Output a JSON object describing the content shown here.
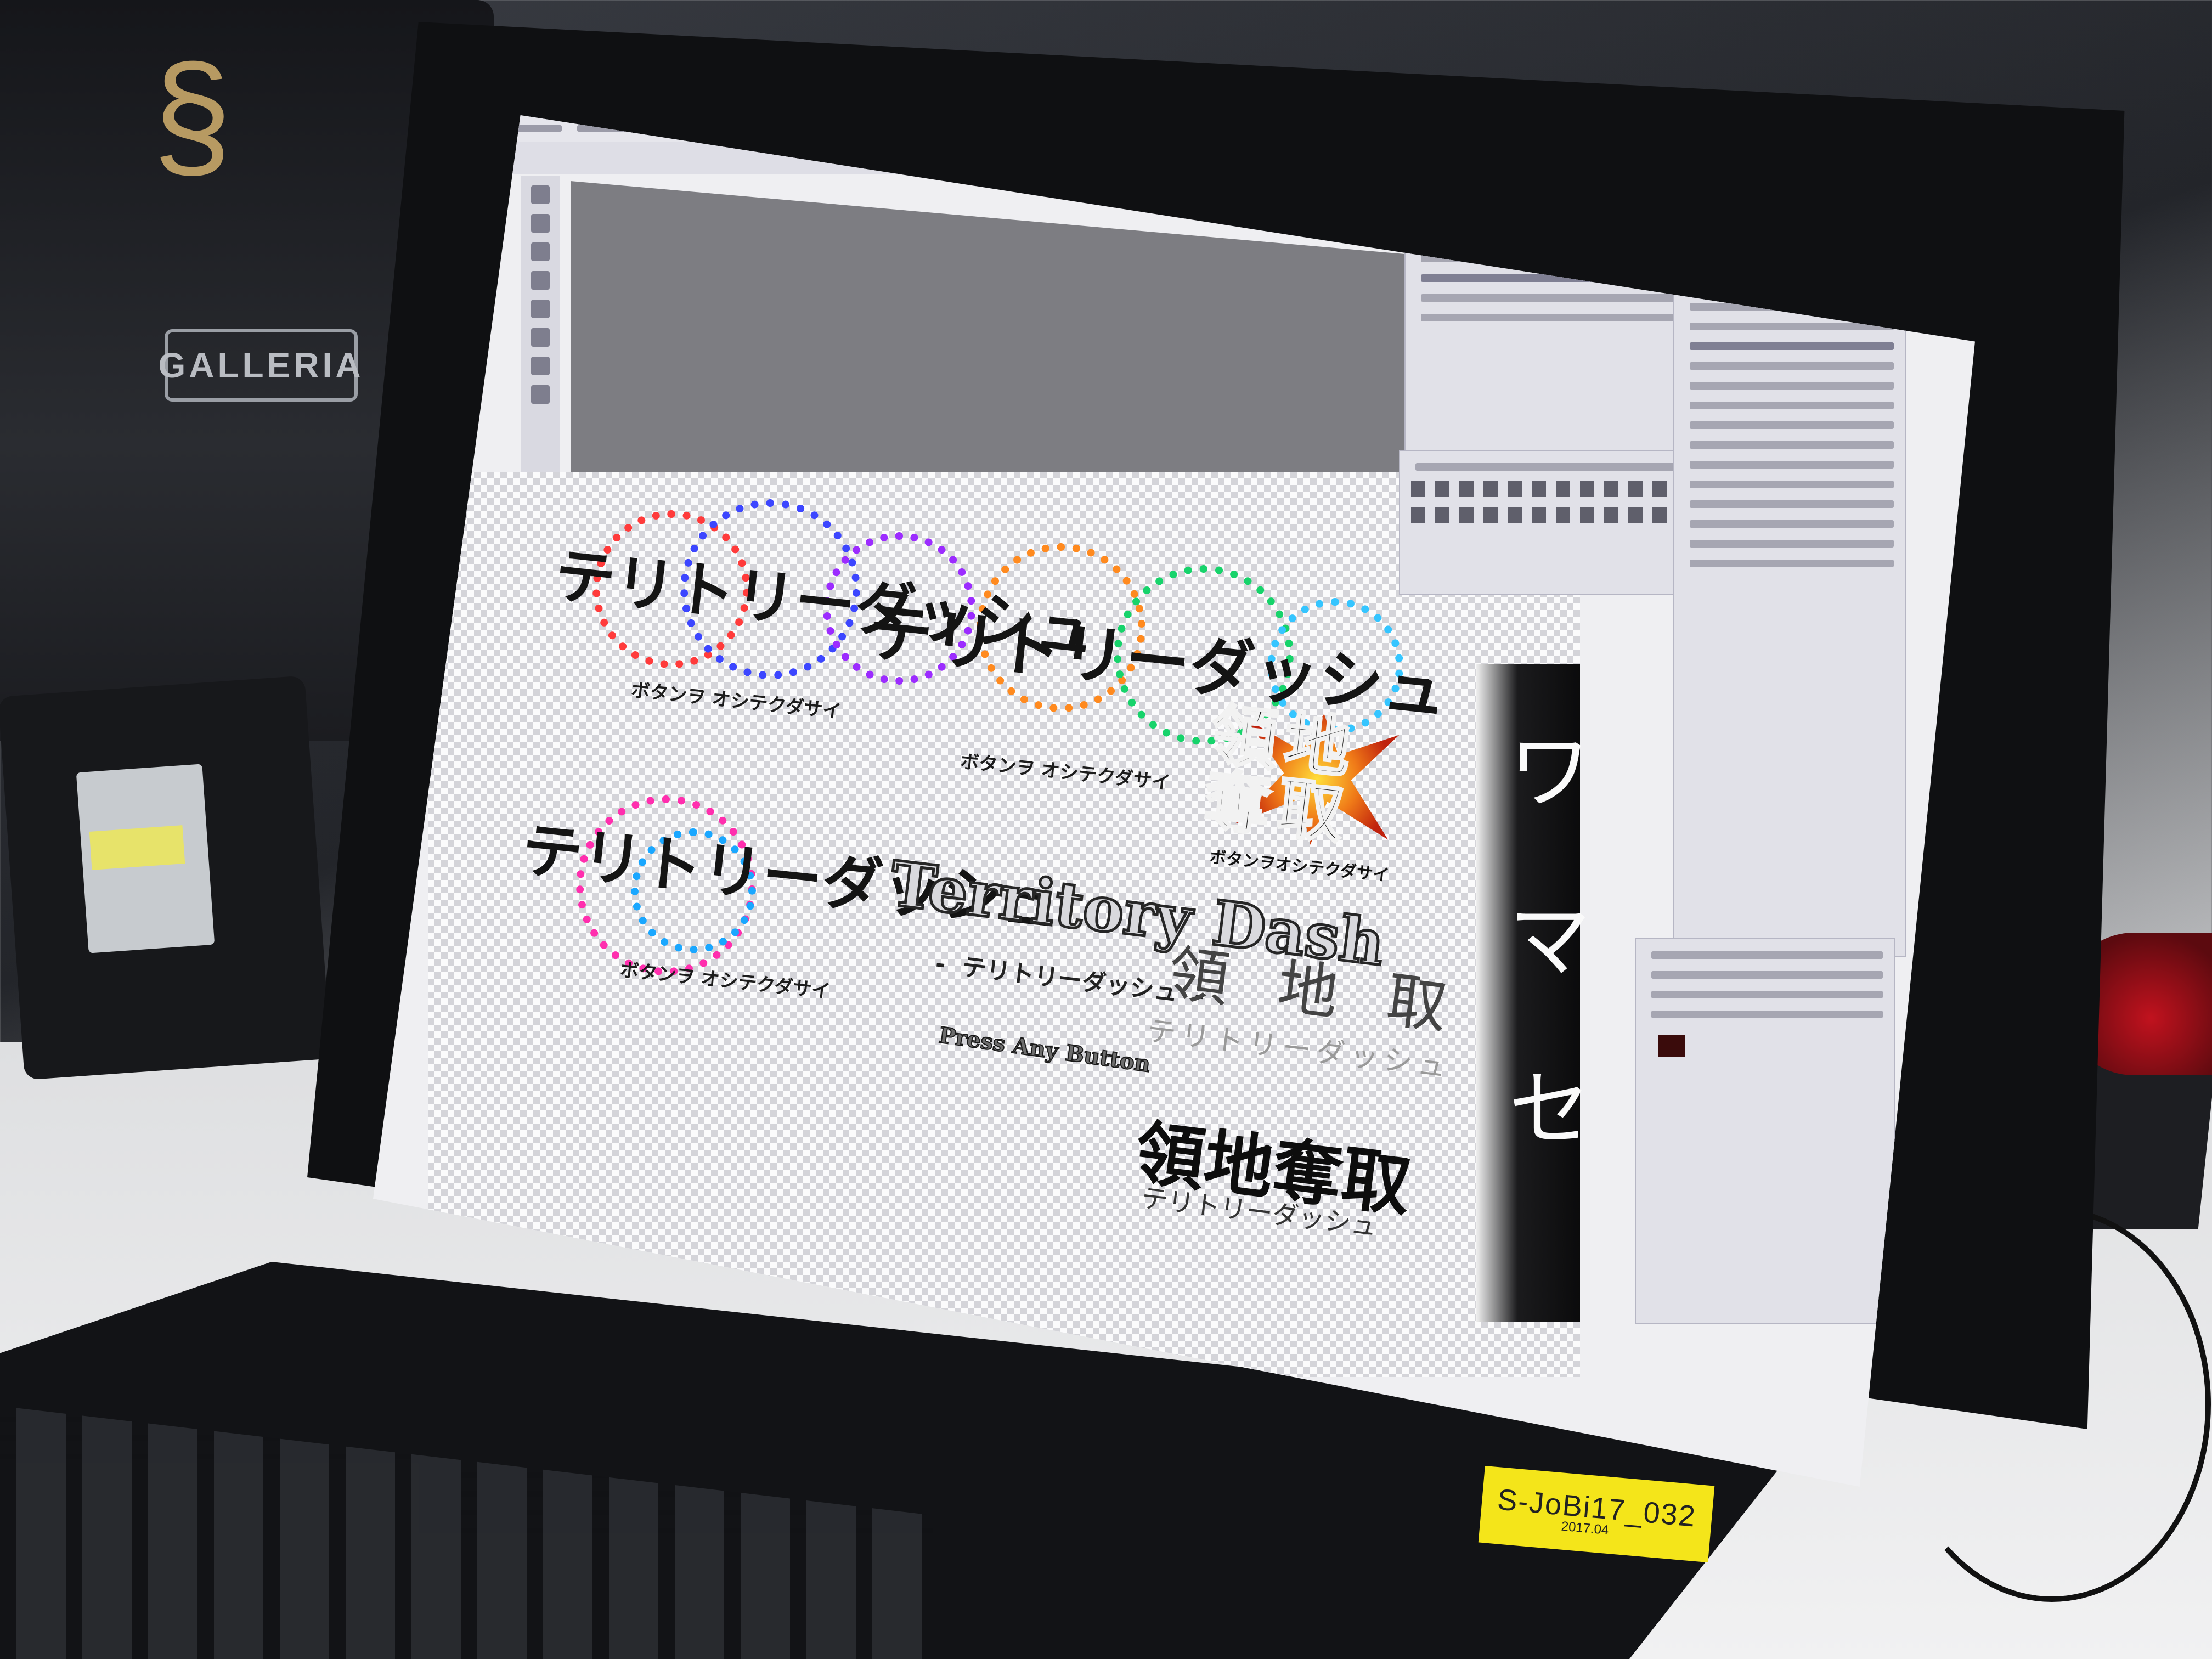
{
  "background": {
    "brand_label": "GALLERIA"
  },
  "canvas_art": {
    "logo_1": {
      "title": "テリトリーダッシュ",
      "subtitle": "ボタンヲ オシテクダサイ"
    },
    "logo_2": {
      "title": "テリトリーダッシュ",
      "subtitle": "ボタンヲ オシテクダサイ"
    },
    "logo_3": {
      "title": "テリトリーダッシュ",
      "subtitle": "ボタンヲ オシテクダサイ"
    },
    "english_logo": {
      "title": "Territory Dash",
      "subtitle": "- テリトリーダッシュ -",
      "prompt": "Press Any Button"
    },
    "emblem": {
      "kanji": "領地奪取",
      "tagline": "ボタンヲオシテクダサイ"
    },
    "thin_logo": {
      "kanji": "領地取",
      "subtitle": "テリトリーダッシュ"
    },
    "bold_logo": {
      "kanji": "領地奪取",
      "subtitle": "テリトリーダッシュ"
    },
    "vertical_text": [
      "ワ",
      "マ",
      "セ"
    ]
  },
  "sticker": {
    "id": "S-JoBi17_032",
    "date": "2017.04"
  },
  "colors": {
    "circle_red": "#ff3b3b",
    "circle_blue": "#3c46ff",
    "circle_purple": "#9c2cff",
    "circle_orange": "#ff8a1f",
    "circle_green": "#17d36b",
    "circle_cyan": "#35c5ff",
    "sticker_yellow": "#f4e51a",
    "emblem_orange": "#f07b18"
  }
}
